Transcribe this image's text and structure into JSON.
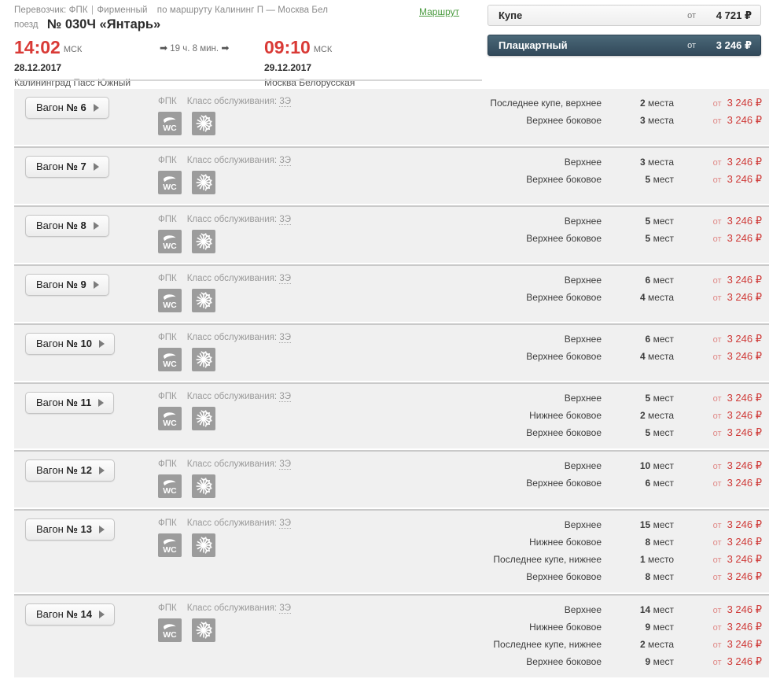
{
  "header": {
    "carrier_prefix": "Перевозчик: ФПК",
    "carrier_sep": "|",
    "carrier_type": "Фирменный",
    "route_of": "по маршруту Калининг П — Москва Бел",
    "route_link": "Маршрут",
    "train_prefix": "поезд",
    "train_name": "№ 030Ч «Янтарь»",
    "departure": {
      "time": "14:02",
      "zone": "МСК",
      "date": "28.12.2017",
      "station": "Калининград Пасс Южный"
    },
    "arrival": {
      "time": "09:10",
      "zone": "МСК",
      "date": "29.12.2017",
      "station": "Москва Белорусская"
    },
    "duration": "19 ч. 8 мин.",
    "arrow": "➡"
  },
  "class_tabs": [
    {
      "label": "Купе",
      "from_label": "от",
      "price": "4 721 ₽",
      "selected": false
    },
    {
      "label": "Плацкартный",
      "from_label": "от",
      "price": "3 246 ₽",
      "selected": true
    }
  ],
  "colors": {
    "accent_red": "#d93a36",
    "price_red": "#cf3a38",
    "link_green": "#4a9b3f",
    "selected_tab": "#3d5a6c",
    "row_bg": "#f0f0f0"
  },
  "common": {
    "operator": "ФПК",
    "class_label": "Класс обслуживания:",
    "class_value": "3Э",
    "from_label": "от",
    "wagon_prefix": "Вагон",
    "amenities": [
      "wc-icon",
      "air-conditioning-icon"
    ]
  },
  "cars": [
    {
      "number": "№ 6",
      "seats": [
        {
          "name": "Последнее купе, верхнее",
          "count": "2 места",
          "count_num": "2",
          "count_word": "места",
          "price": "3 246 ₽"
        },
        {
          "name": "Верхнее боковое",
          "count": "3 места",
          "count_num": "3",
          "count_word": "места",
          "price": "3 246 ₽"
        }
      ]
    },
    {
      "number": "№ 7",
      "seats": [
        {
          "name": "Верхнее",
          "count": "3 места",
          "count_num": "3",
          "count_word": "места",
          "price": "3 246 ₽"
        },
        {
          "name": "Верхнее боковое",
          "count": "5 мест",
          "count_num": "5",
          "count_word": "мест",
          "price": "3 246 ₽"
        }
      ]
    },
    {
      "number": "№ 8",
      "seats": [
        {
          "name": "Верхнее",
          "count": "5 мест",
          "count_num": "5",
          "count_word": "мест",
          "price": "3 246 ₽"
        },
        {
          "name": "Верхнее боковое",
          "count": "5 мест",
          "count_num": "5",
          "count_word": "мест",
          "price": "3 246 ₽"
        }
      ]
    },
    {
      "number": "№ 9",
      "seats": [
        {
          "name": "Верхнее",
          "count": "6 мест",
          "count_num": "6",
          "count_word": "мест",
          "price": "3 246 ₽"
        },
        {
          "name": "Верхнее боковое",
          "count": "4 места",
          "count_num": "4",
          "count_word": "места",
          "price": "3 246 ₽"
        }
      ]
    },
    {
      "number": "№ 10",
      "seats": [
        {
          "name": "Верхнее",
          "count": "6 мест",
          "count_num": "6",
          "count_word": "мест",
          "price": "3 246 ₽"
        },
        {
          "name": "Верхнее боковое",
          "count": "4 места",
          "count_num": "4",
          "count_word": "места",
          "price": "3 246 ₽"
        }
      ]
    },
    {
      "number": "№ 11",
      "seats": [
        {
          "name": "Верхнее",
          "count": "5 мест",
          "count_num": "5",
          "count_word": "мест",
          "price": "3 246 ₽"
        },
        {
          "name": "Нижнее боковое",
          "count": "2 места",
          "count_num": "2",
          "count_word": "места",
          "price": "3 246 ₽"
        },
        {
          "name": "Верхнее боковое",
          "count": "5 мест",
          "count_num": "5",
          "count_word": "мест",
          "price": "3 246 ₽"
        }
      ]
    },
    {
      "number": "№ 12",
      "seats": [
        {
          "name": "Верхнее",
          "count": "10 мест",
          "count_num": "10",
          "count_word": "мест",
          "price": "3 246 ₽"
        },
        {
          "name": "Верхнее боковое",
          "count": "6 мест",
          "count_num": "6",
          "count_word": "мест",
          "price": "3 246 ₽"
        }
      ]
    },
    {
      "number": "№ 13",
      "seats": [
        {
          "name": "Верхнее",
          "count": "15 мест",
          "count_num": "15",
          "count_word": "мест",
          "price": "3 246 ₽"
        },
        {
          "name": "Нижнее боковое",
          "count": "8 мест",
          "count_num": "8",
          "count_word": "мест",
          "price": "3 246 ₽"
        },
        {
          "name": "Последнее купе, нижнее",
          "count": "1 место",
          "count_num": "1",
          "count_word": "место",
          "price": "3 246 ₽"
        },
        {
          "name": "Верхнее боковое",
          "count": "8 мест",
          "count_num": "8",
          "count_word": "мест",
          "price": "3 246 ₽"
        }
      ]
    },
    {
      "number": "№ 14",
      "seats": [
        {
          "name": "Верхнее",
          "count": "14 мест",
          "count_num": "14",
          "count_word": "мест",
          "price": "3 246 ₽"
        },
        {
          "name": "Нижнее боковое",
          "count": "9 мест",
          "count_num": "9",
          "count_word": "мест",
          "price": "3 246 ₽"
        },
        {
          "name": "Последнее купе, нижнее",
          "count": "2 места",
          "count_num": "2",
          "count_word": "места",
          "price": "3 246 ₽"
        },
        {
          "name": "Верхнее боковое",
          "count": "9 мест",
          "count_num": "9",
          "count_word": "мест",
          "price": "3 246 ₽"
        }
      ]
    }
  ]
}
